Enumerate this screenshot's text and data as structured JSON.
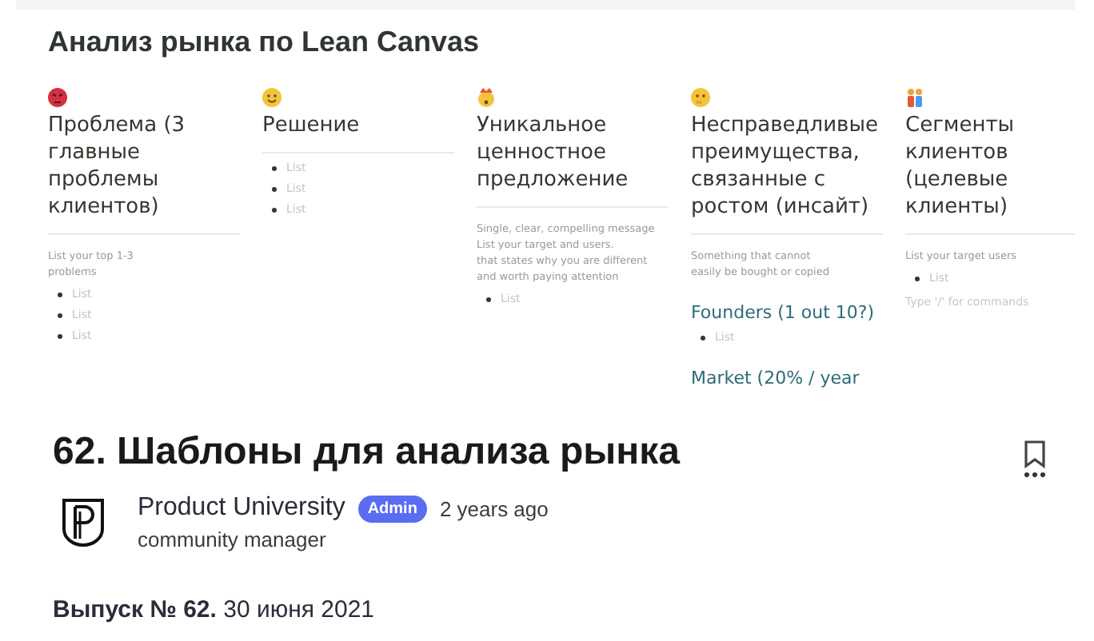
{
  "canvas": {
    "title": "Анализ рынка по Lean Canvas",
    "columns": [
      {
        "kind": "angry",
        "heading": "Проблема (3 главные проблемы клиентов)",
        "hint": [
          "List your top 1-3",
          "problems"
        ],
        "items": [
          "List",
          "List",
          "List"
        ]
      },
      {
        "kind": "smile",
        "heading": "Решение",
        "items": [
          "List",
          "List",
          "List"
        ]
      },
      {
        "kind": "exploding",
        "heading": "Уникальное ценностное предложение",
        "hint": [
          "Single, clear, compelling message",
          "List your target and users.",
          "that states why you are different",
          "and worth paying attention"
        ],
        "items": [
          "List"
        ]
      },
      {
        "kind": "thinking",
        "heading": "Несправедливые преимущества, связанные с ростом (инсайт)",
        "hint": [
          "Something that cannot",
          "easily be bought or copied"
        ],
        "sections": [
          {
            "heading": "Founders (1 out 10?)",
            "items": [
              "List"
            ]
          },
          {
            "heading": "Market (20% / year"
          }
        ]
      },
      {
        "kind": "people",
        "heading": "Сегменты клиентов (целевые клиенты)",
        "hint": [
          "List your target users"
        ],
        "items": [
          "List"
        ],
        "placeholder": "Type '/' for commands"
      }
    ]
  },
  "post": {
    "title": "62. Шаблоны для анализа рынка",
    "bookmarked": false,
    "author": {
      "name": "Product University",
      "badge": "Admin",
      "time": "2 years ago",
      "role": "community manager"
    },
    "issue": "**Выпуск № 62.** 30 июня 2021"
  }
}
